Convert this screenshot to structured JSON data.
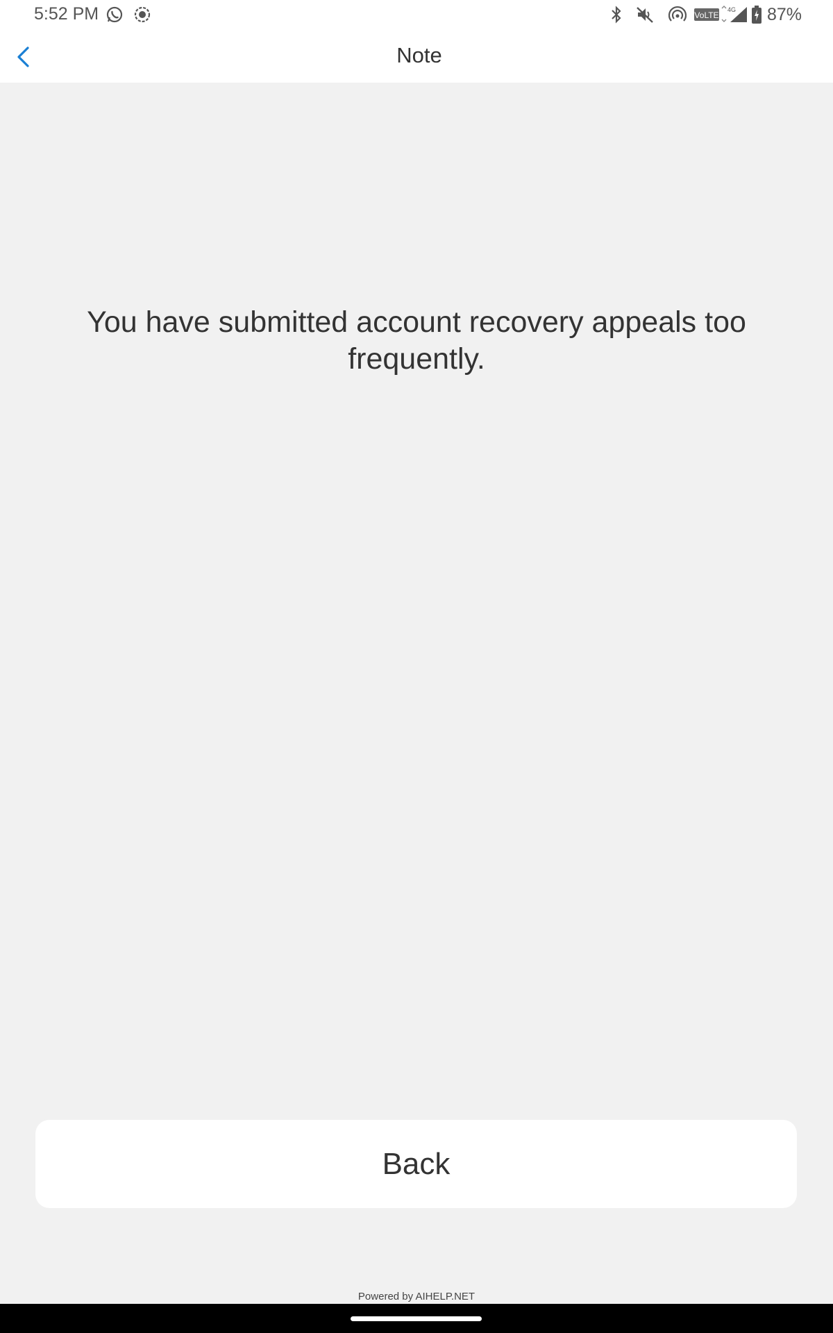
{
  "status_bar": {
    "time": "5:52 PM",
    "battery": "87%",
    "left_icons": [
      "whatsapp-icon",
      "screen-record-icon"
    ],
    "right_icons": [
      "bluetooth-icon",
      "mute-icon",
      "hotspot-icon",
      "volte-icon",
      "signal-4g-icon",
      "battery-icon"
    ],
    "volte_label": "VoLTE",
    "network_label": "4G"
  },
  "app_bar": {
    "title": "Note",
    "accent_color": "#1a7fd4"
  },
  "content": {
    "message": "You have submitted account recovery appeals too frequently."
  },
  "actions": {
    "back_label": "Back"
  },
  "footer": {
    "powered_by": "Powered by AIHELP.NET"
  }
}
